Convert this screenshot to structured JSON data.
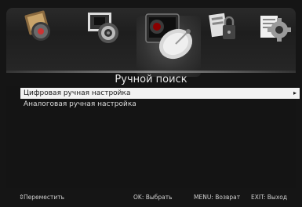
{
  "header": {
    "tabs": [
      {
        "name": "picture",
        "icon": "picture-icon"
      },
      {
        "name": "image",
        "icon": "image-icon"
      },
      {
        "name": "channel",
        "icon": "channel-dish-icon",
        "selected": true
      },
      {
        "name": "lock",
        "icon": "lock-icon"
      },
      {
        "name": "setup",
        "icon": "gear-icon"
      }
    ]
  },
  "page": {
    "title": "Ручной поиск"
  },
  "menu": {
    "items": [
      {
        "label": "Цифровая ручная настройка",
        "selected": true,
        "arrow": "▸"
      },
      {
        "label": "Аналоговая ручная настройка",
        "selected": false
      }
    ]
  },
  "footer": {
    "move_icon": "⇕",
    "move": "Переместить",
    "ok": "OK: Выбрать",
    "menu": "MENU: Возврат",
    "exit": "EXIT: Выход"
  },
  "colors": {
    "background": "#151515",
    "highlight": "#f2f2f2",
    "text": "#dcdcdc"
  }
}
